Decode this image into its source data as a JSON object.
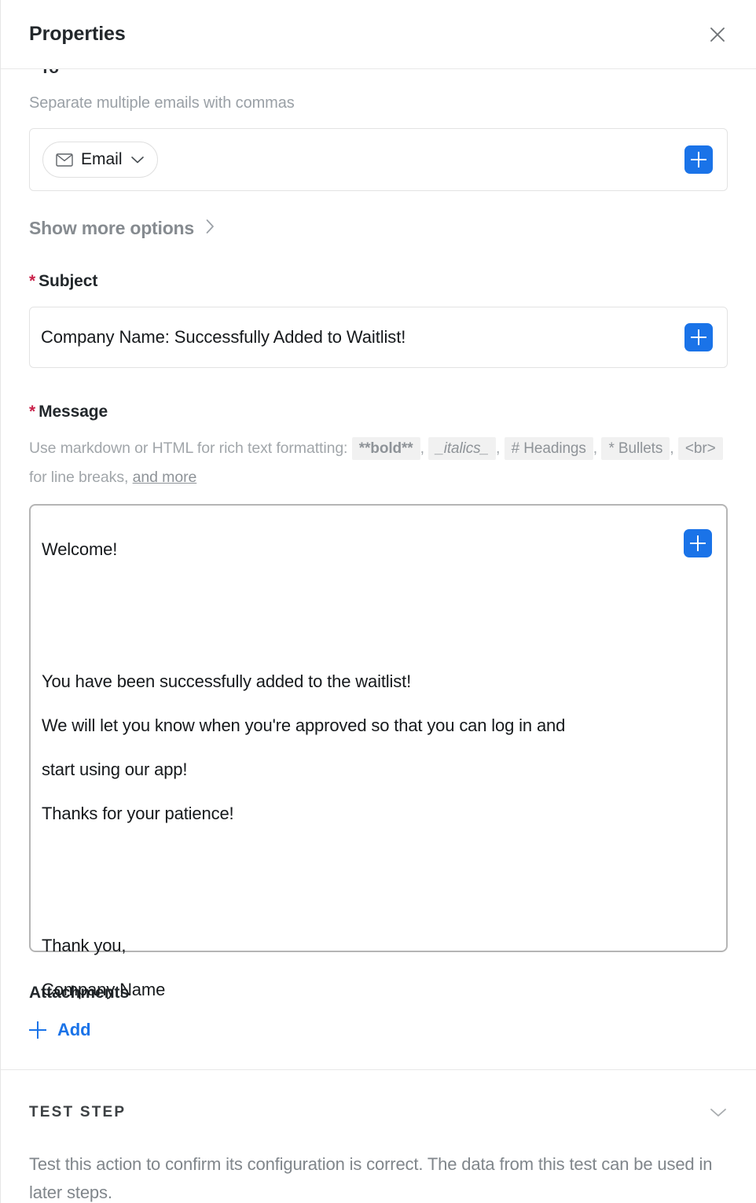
{
  "header": {
    "title": "Properties",
    "close_icon": "close-icon"
  },
  "recipients": {
    "cut_off_label_req": "*",
    "cut_off_label": " To",
    "helper": "Separate multiple emails with commas",
    "chip": {
      "icon": "envelope-icon",
      "label": "Email",
      "chevron_icon": "chevron-down-icon"
    },
    "add_icon": "plus-icon"
  },
  "show_more": {
    "label": "Show more options",
    "chevron_icon": "chevron-right-icon"
  },
  "subject": {
    "required_marker": "*",
    "label": "Subject",
    "value": "Company Name: Successfully Added to Waitlist!",
    "add_icon": "plus-icon"
  },
  "message": {
    "required_marker": "*",
    "label": "Message",
    "hint": {
      "lead": "Use markdown or HTML for rich text formatting:",
      "chips": [
        "**bold**",
        "_italics_",
        "# Headings",
        "* Bullets",
        "<br>"
      ],
      "mid": "for line breaks,",
      "link": "and more",
      "comma": ","
    },
    "value": "Welcome!\n\n\nYou have been successfully added to the waitlist!\nWe will let you know when you're approved so that you can log in and\nstart using our app!\nThanks for your patience!\n\n\nThank you,\nCompany Name",
    "add_icon": "plus-icon"
  },
  "attachments": {
    "label": "Attachments",
    "add_icon": "plus-icon",
    "add_label": "Add"
  },
  "test_step": {
    "title": "TEST STEP",
    "chevron_icon": "chevron-down-icon",
    "description": "Test this action to confirm its configuration is correct. The data from this test can be used in later steps."
  },
  "colors": {
    "accent": "#1a73e8",
    "required": "#c9224a",
    "text": "#16191c",
    "muted": "#80868b",
    "border": "#e3e3e3",
    "focus_border": "#b5b5b5"
  }
}
